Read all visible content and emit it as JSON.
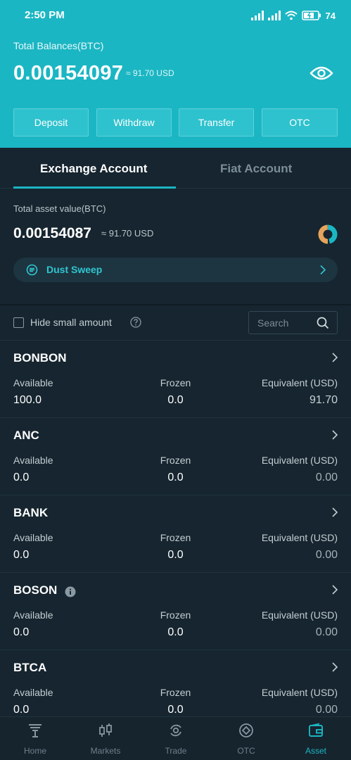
{
  "status_bar": {
    "time": "2:50 PM",
    "battery": "74"
  },
  "header": {
    "label": "Total Balances(BTC)",
    "value": "0.00154097",
    "usd": "≈ 91.70 USD"
  },
  "actions": [
    "Deposit",
    "Withdraw",
    "Transfer",
    "OTC"
  ],
  "tabs": {
    "exchange": "Exchange Account",
    "fiat": "Fiat Account"
  },
  "summary": {
    "label": "Total asset value(BTC)",
    "value": "0.00154087",
    "usd": "≈ 91.70 USD",
    "dust_sweep": "Dust Sweep"
  },
  "filter": {
    "hide_small": "Hide small amount",
    "search_placeholder": "Search"
  },
  "columns": {
    "available": "Available",
    "frozen": "Frozen",
    "equivalent": "Equivalent (USD)"
  },
  "assets": [
    {
      "coin": "BONBON",
      "available": "100.0",
      "frozen": "0.0",
      "equivalent": "91.70"
    },
    {
      "coin": "ANC",
      "available": "0.0",
      "frozen": "0.0",
      "equivalent": "0.00"
    },
    {
      "coin": "BANK",
      "available": "0.0",
      "frozen": "0.0",
      "equivalent": "0.00"
    },
    {
      "coin": "BOSON",
      "available": "0.0",
      "frozen": "0.0",
      "equivalent": "0.00"
    },
    {
      "coin": "BTCA",
      "available": "0.0",
      "frozen": "0.0",
      "equivalent": "0.00"
    }
  ],
  "nav": [
    "Home",
    "Markets",
    "Trade",
    "OTC",
    "Asset"
  ],
  "colors": {
    "accent": "#1bb6c3",
    "background": "#14232f",
    "panel": "#16252f"
  }
}
